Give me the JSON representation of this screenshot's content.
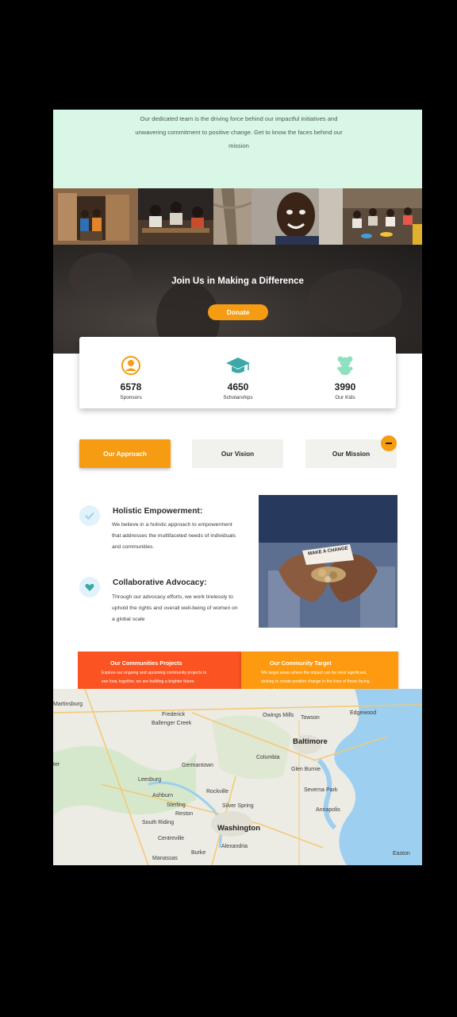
{
  "intro": {
    "text": "Our dedicated team is the driving force behind our impactful initiatives and unwavering commitment to positive change. Get to know the faces behind our mission"
  },
  "hero": {
    "title": "Join Us in Making a Difference",
    "donate_label": "Donate"
  },
  "stats": [
    {
      "icon": "user-circle-icon",
      "value": "6578",
      "label": "Sponsors"
    },
    {
      "icon": "graduation-cap-icon",
      "value": "4650",
      "label": "Scholarships"
    },
    {
      "icon": "teddy-bear-icon",
      "value": "3990",
      "label": "Our Kids"
    }
  ],
  "tabs": {
    "approach": "Our Approach",
    "vision": "Our Vision",
    "mission": "Our Mission"
  },
  "features": [
    {
      "icon": "check-icon",
      "title": "Holistic Empowerment:",
      "text": "We believe in a holistic approach to empowerment that addresses the multifaceted needs of individuals and communities."
    },
    {
      "icon": "heart-icon",
      "title": "Collaborative Advocacy:",
      "text": "Through our advocacy efforts, we work tirelessly to uphold the rights and overall well-being of women on a global scale"
    }
  ],
  "hands_note": "MAKE A CHANGE",
  "banners": [
    {
      "title": "Our Communities Projects",
      "text": "Explore our ongoing and upcoming community projects to see how, together, we are building a brighter future."
    },
    {
      "title": "Our Community Target",
      "text": "We target areas where the impact can be most significant, striving to create positive change in the lives of those facing adversity."
    }
  ],
  "map": {
    "labels": {
      "martinsburg": "Martinsburg",
      "frederick": "Frederick",
      "ballenger": "Ballenger Creek",
      "owings": "Owings Mills",
      "towson": "Towson",
      "edgewood": "Edgewood",
      "baltimore": "Baltimore",
      "germantown": "Germantown",
      "columbia": "Columbia",
      "glenburnie": "Glen Burnie",
      "leesburg": "Leesburg",
      "rockville": "Rockville",
      "severna": "Severna Park",
      "ashburn": "Ashburn",
      "sterling": "Sterling",
      "reston": "Reston",
      "silverspring": "Silver Spring",
      "annapolis": "Annapolis",
      "southriding": "South Riding",
      "washington": "Washington",
      "centreville": "Centreville",
      "alexandria": "Alexandria",
      "burke": "Burke",
      "manassas": "Manassas",
      "easton": "Easton",
      "edge": "ter"
    }
  },
  "colors": {
    "accent": "#f59c12",
    "mint": "#d8f7e6",
    "banner_left": "#fb5322",
    "banner_right": "#fd9a10",
    "teal": "#3aa9a7"
  }
}
